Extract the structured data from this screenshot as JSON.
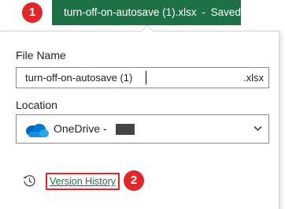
{
  "titlebar": {
    "filename": "turn-off-on-autosave (1).xlsx",
    "separator": "-",
    "status": "Saved",
    "caret_icon": "caret-down-icon",
    "color": "#1e7145"
  },
  "callouts": {
    "first": "1",
    "second": "2",
    "color": "#e0282c"
  },
  "panel": {
    "file_name_label": "File Name",
    "file_name_value": "turn-off-on-autosave (1)",
    "file_extension": ".xlsx",
    "location_label": "Location",
    "location_value": "OneDrive -",
    "location_icon": "onedrive-cloud-icon",
    "dropdown_icon": "chevron-down-icon",
    "history_icon": "history-clock-icon",
    "version_history_label": "Version History",
    "link_color": "#1e7145"
  }
}
